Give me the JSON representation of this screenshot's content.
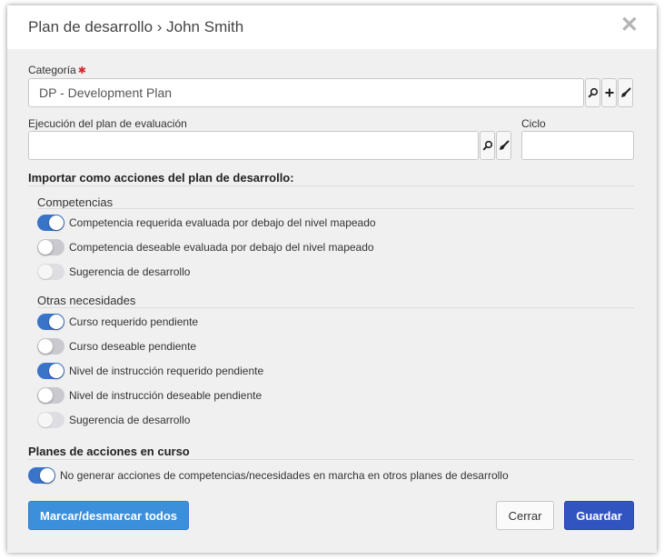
{
  "dialog": {
    "title": "Plan de desarrollo › John Smith",
    "close_glyph": "✕"
  },
  "category": {
    "label": "Categoría",
    "required_mark": "✱",
    "value": "DP - Development Plan",
    "icons": [
      "search-icon",
      "plus-icon",
      "clear-icon"
    ]
  },
  "evaluation": {
    "label": "Ejecución del plan de evaluación",
    "value": "",
    "icons": [
      "search-icon",
      "clear-icon"
    ]
  },
  "cycle": {
    "label": "Ciclo",
    "value": ""
  },
  "import_section": {
    "title": "Importar como acciones del plan de desarrollo:",
    "competencies": {
      "title": "Competencias",
      "items": [
        {
          "label": "Competencia requerida evaluada por debajo del nivel mapeado",
          "state": "on"
        },
        {
          "label": "Competencia deseable evaluada por debajo del nivel mapeado",
          "state": "off"
        },
        {
          "label": "Sugerencia de desarrollo",
          "state": "disabled"
        }
      ]
    },
    "other_needs": {
      "title": "Otras necesidades",
      "items": [
        {
          "label": "Curso requerido pendiente",
          "state": "on"
        },
        {
          "label": "Curso deseable pendiente",
          "state": "off"
        },
        {
          "label": "Nivel de instrucción requerido pendiente",
          "state": "on"
        },
        {
          "label": "Nivel de instrucción deseable pendiente",
          "state": "off"
        },
        {
          "label": "Sugerencia de desarrollo",
          "state": "disabled"
        }
      ]
    }
  },
  "ongoing_section": {
    "title": "Planes de acciones en curso",
    "items": [
      {
        "label": "No generar acciones de competencias/necesidades en marcha en otros planes de desarrollo",
        "state": "on"
      }
    ]
  },
  "footer": {
    "toggle_all_label": "Marcar/desmarcar todos",
    "close_label": "Cerrar",
    "save_label": "Guardar"
  },
  "colors": {
    "toggle_on": "#3a74c9",
    "primary_button": "#3154c1",
    "secondary_button": "#3c8fdb",
    "required": "#d9262b"
  }
}
